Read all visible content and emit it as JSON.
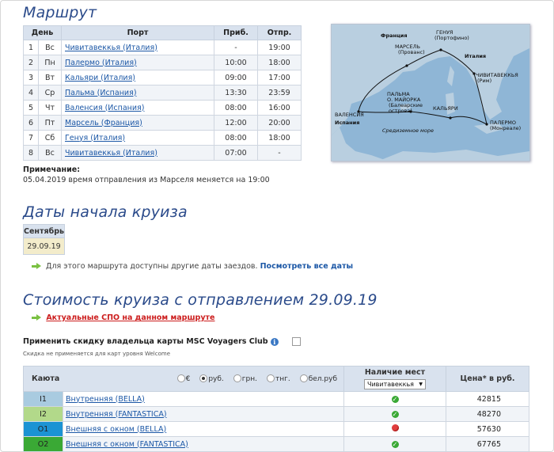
{
  "itinerary": {
    "title": "Маршрут",
    "headers": [
      "День",
      "Порт",
      "Приб.",
      "Отпр."
    ],
    "rows": [
      {
        "n": "1",
        "day": "Вс",
        "port": "Чивитавеккья (Италия)",
        "arr": "-",
        "dep": "19:00"
      },
      {
        "n": "2",
        "day": "Пн",
        "port": "Палермо (Италия)",
        "arr": "10:00",
        "dep": "18:00"
      },
      {
        "n": "3",
        "day": "Вт",
        "port": "Кальяри (Италия)",
        "arr": "09:00",
        "dep": "17:00"
      },
      {
        "n": "4",
        "day": "Ср",
        "port": "Пальма (Испания)",
        "arr": "13:30",
        "dep": "23:59"
      },
      {
        "n": "5",
        "day": "Чт",
        "port": "Валенсия (Испания)",
        "arr": "08:00",
        "dep": "16:00"
      },
      {
        "n": "6",
        "day": "Пт",
        "port": "Марсель (Франция)",
        "arr": "12:00",
        "dep": "20:00"
      },
      {
        "n": "7",
        "day": "Сб",
        "port": "Генуя (Италия)",
        "arr": "08:00",
        "dep": "18:00"
      },
      {
        "n": "8",
        "day": "Вс",
        "port": "Чивитавеккья (Италия)",
        "arr": "07:00",
        "dep": "-"
      }
    ]
  },
  "map": {
    "labels": {
      "france": "Франция",
      "italy": "Италия",
      "spain": "Испания",
      "genoa": "ГЕНУЯ",
      "genoa_sub": "(Портофино)",
      "marseille": "МАРСЕЛЬ",
      "marseille_sub": "(Прованс)",
      "civitavecchia": "ЧИВИТАВЕККЬЯ",
      "civitavecchia_sub": "(Рим)",
      "palma": "ПАЛЬМА",
      "palma_2": "О. МАЙОРКА",
      "palma_sub": "(Балеарские",
      "palma_sub2": "острова)",
      "valencia": "ВАЛЕНСИЯ",
      "cagliari": "КАЛЬЯРИ",
      "palermo": "ПАЛЕРМО",
      "palermo_sub": "(Монреале)",
      "sea": "Средиземное море"
    }
  },
  "note": {
    "title": "Примечание:",
    "text": "05.04.2019 время отправления из Марселя меняется на 19:00"
  },
  "dates": {
    "title": "Даты начала круиза",
    "month": "Сентябрь",
    "date": "29.09.19",
    "info_text": "Для этого маршрута доступны другие даты заездов.",
    "info_link": "Посмотреть все даты"
  },
  "cost": {
    "title": "Стоимость круиза с отправлением 29.09.19",
    "spo_link": "Актуальные СПО на данном маршруте",
    "discount_label": "Применить скидку владельца карты MSC Voyagers Club",
    "discount_note": "Скидка не применяется для карт уровня Welcome"
  },
  "cabins": {
    "col_cabin": "Каюта",
    "currencies": [
      "€",
      "руб.",
      "грн.",
      "тнг.",
      "бел.руб"
    ],
    "selected_currency": "руб.",
    "col_availability": "Наличие мест",
    "port_select": "Чивитавеккья",
    "col_price": "Цена* в руб.",
    "rows": [
      {
        "code": "I1",
        "name": "Внутренняя (BELLA)",
        "available": true,
        "price": "42815",
        "color": "#a9cbe0"
      },
      {
        "code": "I2",
        "name": "Внутренняя (FANTASTICA)",
        "available": true,
        "price": "48270",
        "color": "#b2d98a"
      },
      {
        "code": "O1",
        "name": "Внешняя с окном (BELLA)",
        "available": false,
        "price": "57630",
        "color": "#1b93d4"
      },
      {
        "code": "O2",
        "name": "Внешняя с окном (FANTASTICA)",
        "available": true,
        "price": "67765",
        "color": "#3aa935"
      }
    ]
  },
  "colors": {
    "heading": "#2a4a8a",
    "link": "#1b57a6",
    "spo": "#cc1d1d",
    "arrow": "#7ac142",
    "header_bg": "#d9e2ee",
    "date_bg": "#f3eccb"
  }
}
